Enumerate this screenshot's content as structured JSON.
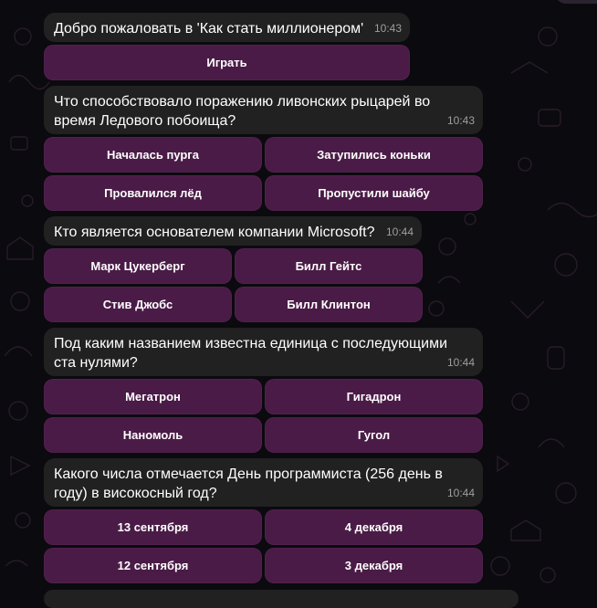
{
  "colors": {
    "background": "#0b0a0f",
    "bubble": "#212121",
    "button": "#6a2a62",
    "timestamp": "#9e9e9e"
  },
  "messages": [
    {
      "text": "Добро пожаловать в 'Как стать миллионером'",
      "time": "10:43",
      "buttons": [
        "Играть"
      ]
    },
    {
      "text": "Что способствовало поражению ливонских рыцарей во время Ледового побоища?",
      "time": "10:43",
      "buttons": [
        "Началась пурга",
        "Затупились коньки",
        "Провалился лёд",
        "Пропустили шайбу"
      ]
    },
    {
      "text": "Кто является основателем компании Microsoft?",
      "time": "10:44",
      "buttons": [
        "Марк Цукерберг",
        "Билл Гейтс",
        "Стив Джобс",
        "Билл Клинтон"
      ]
    },
    {
      "text": "Под каким названием известна единица с последующими ста нулями?",
      "time": "10:44",
      "buttons": [
        "Мегатрон",
        "Гигадрон",
        "Наномоль",
        "Гугол"
      ]
    },
    {
      "text": "Какого числа отмечается День программиста (256 день в году) в високосный год?",
      "time": "10:44",
      "buttons": [
        "13 сентября",
        "4 декабря",
        "12 сентября",
        "3 декабря"
      ]
    }
  ]
}
